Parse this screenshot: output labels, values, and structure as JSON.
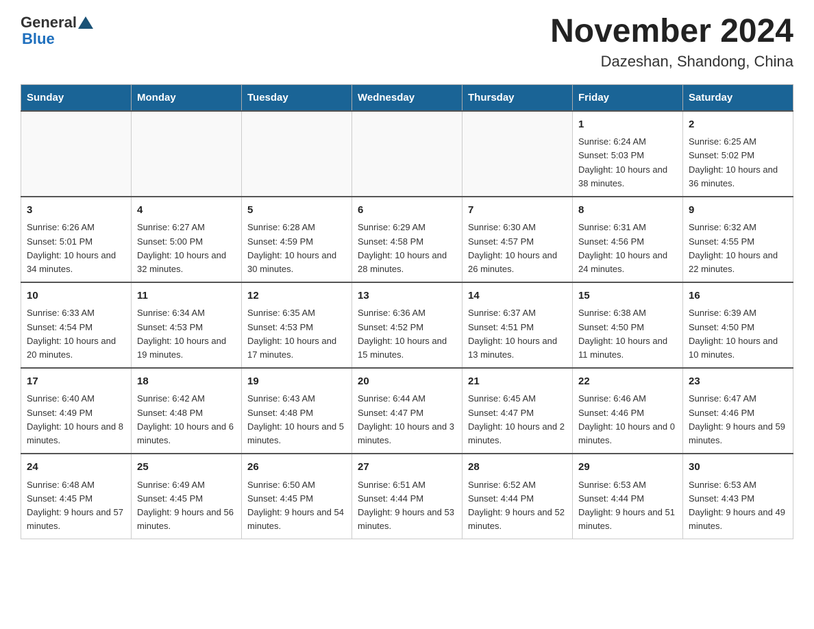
{
  "logo": {
    "general": "General",
    "blue": "Blue"
  },
  "title": "November 2024",
  "subtitle": "Dazeshan, Shandong, China",
  "weekdays": [
    "Sunday",
    "Monday",
    "Tuesday",
    "Wednesday",
    "Thursday",
    "Friday",
    "Saturday"
  ],
  "weeks": [
    [
      {
        "day": "",
        "info": ""
      },
      {
        "day": "",
        "info": ""
      },
      {
        "day": "",
        "info": ""
      },
      {
        "day": "",
        "info": ""
      },
      {
        "day": "",
        "info": ""
      },
      {
        "day": "1",
        "info": "Sunrise: 6:24 AM\nSunset: 5:03 PM\nDaylight: 10 hours and 38 minutes."
      },
      {
        "day": "2",
        "info": "Sunrise: 6:25 AM\nSunset: 5:02 PM\nDaylight: 10 hours and 36 minutes."
      }
    ],
    [
      {
        "day": "3",
        "info": "Sunrise: 6:26 AM\nSunset: 5:01 PM\nDaylight: 10 hours and 34 minutes."
      },
      {
        "day": "4",
        "info": "Sunrise: 6:27 AM\nSunset: 5:00 PM\nDaylight: 10 hours and 32 minutes."
      },
      {
        "day": "5",
        "info": "Sunrise: 6:28 AM\nSunset: 4:59 PM\nDaylight: 10 hours and 30 minutes."
      },
      {
        "day": "6",
        "info": "Sunrise: 6:29 AM\nSunset: 4:58 PM\nDaylight: 10 hours and 28 minutes."
      },
      {
        "day": "7",
        "info": "Sunrise: 6:30 AM\nSunset: 4:57 PM\nDaylight: 10 hours and 26 minutes."
      },
      {
        "day": "8",
        "info": "Sunrise: 6:31 AM\nSunset: 4:56 PM\nDaylight: 10 hours and 24 minutes."
      },
      {
        "day": "9",
        "info": "Sunrise: 6:32 AM\nSunset: 4:55 PM\nDaylight: 10 hours and 22 minutes."
      }
    ],
    [
      {
        "day": "10",
        "info": "Sunrise: 6:33 AM\nSunset: 4:54 PM\nDaylight: 10 hours and 20 minutes."
      },
      {
        "day": "11",
        "info": "Sunrise: 6:34 AM\nSunset: 4:53 PM\nDaylight: 10 hours and 19 minutes."
      },
      {
        "day": "12",
        "info": "Sunrise: 6:35 AM\nSunset: 4:53 PM\nDaylight: 10 hours and 17 minutes."
      },
      {
        "day": "13",
        "info": "Sunrise: 6:36 AM\nSunset: 4:52 PM\nDaylight: 10 hours and 15 minutes."
      },
      {
        "day": "14",
        "info": "Sunrise: 6:37 AM\nSunset: 4:51 PM\nDaylight: 10 hours and 13 minutes."
      },
      {
        "day": "15",
        "info": "Sunrise: 6:38 AM\nSunset: 4:50 PM\nDaylight: 10 hours and 11 minutes."
      },
      {
        "day": "16",
        "info": "Sunrise: 6:39 AM\nSunset: 4:50 PM\nDaylight: 10 hours and 10 minutes."
      }
    ],
    [
      {
        "day": "17",
        "info": "Sunrise: 6:40 AM\nSunset: 4:49 PM\nDaylight: 10 hours and 8 minutes."
      },
      {
        "day": "18",
        "info": "Sunrise: 6:42 AM\nSunset: 4:48 PM\nDaylight: 10 hours and 6 minutes."
      },
      {
        "day": "19",
        "info": "Sunrise: 6:43 AM\nSunset: 4:48 PM\nDaylight: 10 hours and 5 minutes."
      },
      {
        "day": "20",
        "info": "Sunrise: 6:44 AM\nSunset: 4:47 PM\nDaylight: 10 hours and 3 minutes."
      },
      {
        "day": "21",
        "info": "Sunrise: 6:45 AM\nSunset: 4:47 PM\nDaylight: 10 hours and 2 minutes."
      },
      {
        "day": "22",
        "info": "Sunrise: 6:46 AM\nSunset: 4:46 PM\nDaylight: 10 hours and 0 minutes."
      },
      {
        "day": "23",
        "info": "Sunrise: 6:47 AM\nSunset: 4:46 PM\nDaylight: 9 hours and 59 minutes."
      }
    ],
    [
      {
        "day": "24",
        "info": "Sunrise: 6:48 AM\nSunset: 4:45 PM\nDaylight: 9 hours and 57 minutes."
      },
      {
        "day": "25",
        "info": "Sunrise: 6:49 AM\nSunset: 4:45 PM\nDaylight: 9 hours and 56 minutes."
      },
      {
        "day": "26",
        "info": "Sunrise: 6:50 AM\nSunset: 4:45 PM\nDaylight: 9 hours and 54 minutes."
      },
      {
        "day": "27",
        "info": "Sunrise: 6:51 AM\nSunset: 4:44 PM\nDaylight: 9 hours and 53 minutes."
      },
      {
        "day": "28",
        "info": "Sunrise: 6:52 AM\nSunset: 4:44 PM\nDaylight: 9 hours and 52 minutes."
      },
      {
        "day": "29",
        "info": "Sunrise: 6:53 AM\nSunset: 4:44 PM\nDaylight: 9 hours and 51 minutes."
      },
      {
        "day": "30",
        "info": "Sunrise: 6:53 AM\nSunset: 4:43 PM\nDaylight: 9 hours and 49 minutes."
      }
    ]
  ]
}
